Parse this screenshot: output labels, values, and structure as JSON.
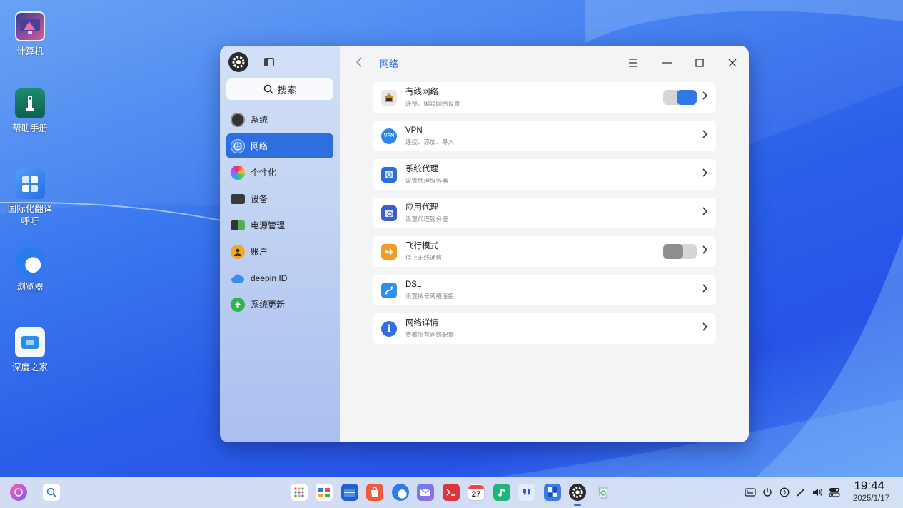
{
  "desktop": {
    "icons": [
      {
        "label": "计算机"
      },
      {
        "label": "帮助手册"
      },
      {
        "label": "国际化翻译呼吁"
      },
      {
        "label": "浏览器"
      },
      {
        "label": "深度之家"
      }
    ]
  },
  "window": {
    "sidebar": {
      "search_label": "搜索",
      "items": [
        {
          "label": "系统",
          "icon": "system-icon"
        },
        {
          "label": "网络",
          "icon": "network-icon"
        },
        {
          "label": "个性化",
          "icon": "personalization-icon"
        },
        {
          "label": "设备",
          "icon": "device-icon"
        },
        {
          "label": "电源管理",
          "icon": "power-icon"
        },
        {
          "label": "账户",
          "icon": "account-icon"
        },
        {
          "label": "deepin ID",
          "icon": "cloud-icon"
        },
        {
          "label": "系统更新",
          "icon": "update-icon"
        }
      ]
    },
    "header": {
      "title": "网络"
    },
    "cards": [
      {
        "title": "有线网络",
        "subtitle": "连接、编辑网络设置",
        "toggle": true
      },
      {
        "title": "VPN",
        "subtitle": "连接、添加、导入"
      },
      {
        "title": "系统代理",
        "subtitle": "设置代理服务器"
      },
      {
        "title": "应用代理",
        "subtitle": "设置代理服务器"
      },
      {
        "title": "飞行模式",
        "subtitle": "停止无线通信",
        "toggle": false
      },
      {
        "title": "DSL",
        "subtitle": "设置拨号网络连接"
      },
      {
        "title": "网络详情",
        "subtitle": "查看所有网络配置"
      }
    ]
  },
  "taskbar": {
    "calendar_day": "27",
    "time": "19:44",
    "date": "2025/1/17"
  },
  "colors": {
    "accent": "#2e6fe0",
    "toggle_on": "#2f7ae6",
    "toggle_off": "#8e8e8e"
  }
}
